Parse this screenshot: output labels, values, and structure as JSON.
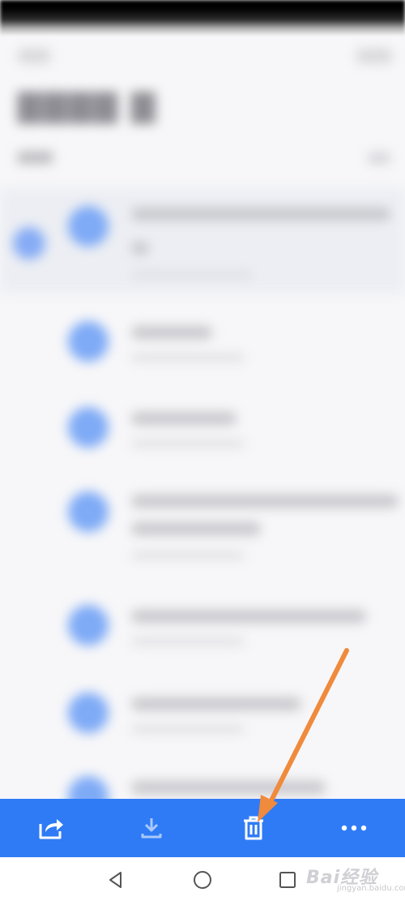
{
  "toolbar": {
    "actions": [
      {
        "name": "share",
        "icon": "share-icon"
      },
      {
        "name": "download",
        "icon": "download-icon"
      },
      {
        "name": "delete",
        "icon": "trash-icon"
      },
      {
        "name": "more",
        "icon": "more-horizontal-icon"
      }
    ],
    "background_color": "#2f7bf6"
  },
  "system_nav": {
    "buttons": [
      {
        "name": "back",
        "icon": "back-triangle-icon"
      },
      {
        "name": "home",
        "icon": "home-circle-icon"
      },
      {
        "name": "recents",
        "icon": "recents-square-icon"
      }
    ]
  },
  "watermark": {
    "text": "Bai经验",
    "sub": "jingyan.baidu.com"
  },
  "annotation": {
    "arrow_color": "#f08a3c",
    "points_to": "delete"
  },
  "colors": {
    "accent": "#2f7bf6",
    "file_icon": "#7eaaf6"
  }
}
